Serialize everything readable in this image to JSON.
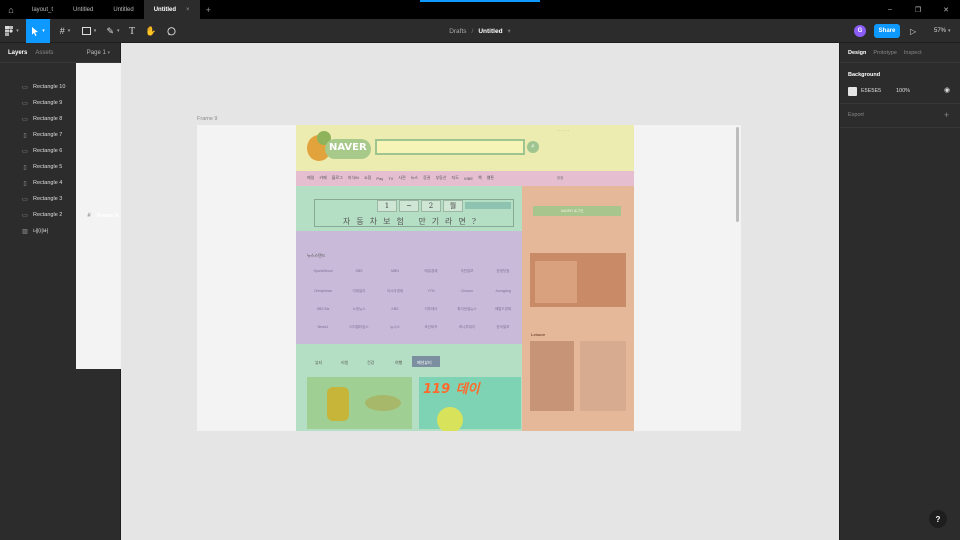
{
  "titlebar": {
    "tabs": [
      {
        "label": "layout_t",
        "active": false
      },
      {
        "label": "Untitled",
        "active": false
      },
      {
        "label": "Untitled",
        "active": false
      },
      {
        "label": "Untitled",
        "active": true
      }
    ],
    "close": "×",
    "new_tab": "+",
    "window_controls": {
      "minimize": "–",
      "restore": "❐",
      "close": "✕"
    }
  },
  "toolbar": {
    "breadcrumb": {
      "project": "Drafts",
      "separator": "/",
      "file": "Untitled",
      "caret": "▾"
    },
    "avatar_initial": "G",
    "share_label": "Share",
    "play": "▷",
    "zoom": "57%",
    "zoom_caret": "▾"
  },
  "left_panel": {
    "tabs": {
      "layers": "Layers",
      "assets": "Assets",
      "page": "Page 1",
      "page_caret": "▾"
    },
    "layers": [
      {
        "name": "Frame 9",
        "icon": "#",
        "kind": "frame"
      },
      {
        "name": "Rectangle 10",
        "icon": "▭",
        "kind": "rect"
      },
      {
        "name": "Rectangle 9",
        "icon": "▭",
        "kind": "rect"
      },
      {
        "name": "Rectangle 8",
        "icon": "▭",
        "kind": "rect"
      },
      {
        "name": "Rectangle 7",
        "icon": "▯",
        "kind": "rect"
      },
      {
        "name": "Rectangle 6",
        "icon": "▭",
        "kind": "rect"
      },
      {
        "name": "Rectangle 5",
        "icon": "▯",
        "kind": "rect"
      },
      {
        "name": "Rectangle 4",
        "icon": "▯",
        "kind": "rect"
      },
      {
        "name": "Rectangle 3",
        "icon": "▭",
        "kind": "rect"
      },
      {
        "name": "Rectangle 2",
        "icon": "▭",
        "kind": "rect"
      },
      {
        "name": "네이버",
        "icon": "▨",
        "kind": "image"
      }
    ]
  },
  "canvas": {
    "frame_label": "Frame 9",
    "naver": {
      "logo": "NAVER",
      "banner_cells": [
        "1",
        "~",
        "2",
        "월"
      ],
      "banner_caption": "자동차보험 만기라면?",
      "login_button": "NAVER 로그인",
      "ad_119": "119",
      "ad_119_word": "데이",
      "news_label": "뉴스스탠드",
      "shop_label": "쇼핑",
      "tabs": [
        "뷰티",
        "리빙",
        "건강",
        "여행",
        "패션뷰티"
      ],
      "grid_labels": [
        "SportsSeoul",
        "SBS",
        "MBN",
        "매일경제",
        "국민일보",
        "한경닷컴",
        "OhmyNews",
        "이데일리",
        "아시아경제",
        "YTN",
        "Chosun",
        "JoongAng",
        "SBS Biz",
        "노컷뉴스",
        "KBS",
        "이투데이",
        "파이낸셜뉴스",
        "헤럴드경제",
        "News1",
        "디지털타임스",
        "뉴시스",
        "조선비즈",
        "머니투데이",
        "한국일보"
      ],
      "side_caption": "Leisure",
      "weather": "맑음"
    }
  },
  "right_panel": {
    "tabs": {
      "design": "Design",
      "prototype": "Prototype",
      "inspect": "Inspect"
    },
    "background_label": "Background",
    "background_hex": "E5E5E5",
    "background_opacity": "100%",
    "eye": "◉",
    "export_label": "Export",
    "export_plus": "+"
  },
  "colors": {
    "accent": "#0d99ff",
    "canvas_bg": "#e5e5e5",
    "panel_bg": "#2c2c2c",
    "rect_yellow": "#ecebb0",
    "rect_green": "#b5dfc4",
    "rect_purple": "#c8bad8",
    "rect_orange": "#e5b89a",
    "rect_pink": "#e5bfcf"
  },
  "help": "?"
}
